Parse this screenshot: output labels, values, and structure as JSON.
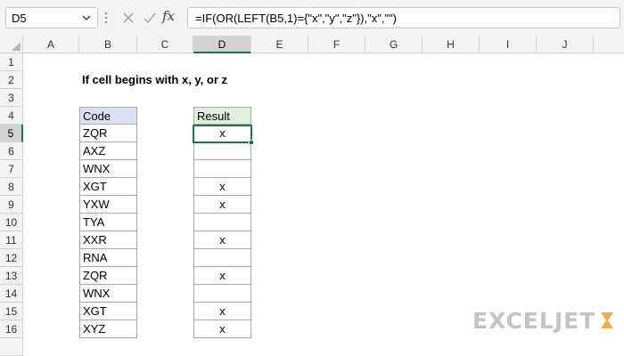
{
  "formula_bar": {
    "name_box": "D5",
    "fx_label": "fx",
    "formula": "=IF(OR(LEFT(B5,1)={\"x\",\"y\",\"z\"}),\"x\",\"\")"
  },
  "columns": [
    "A",
    "B",
    "C",
    "D",
    "E",
    "F",
    "G",
    "H",
    "I",
    "J"
  ],
  "active_column": "D",
  "rows": [
    "1",
    "2",
    "3",
    "4",
    "5",
    "6",
    "7",
    "8",
    "9",
    "10",
    "11",
    "12",
    "13",
    "14",
    "15",
    "16"
  ],
  "active_row": "5",
  "sheet": {
    "title": "If cell begins with x, y, or z",
    "code_header": "Code",
    "result_header": "Result",
    "codes": [
      "ZQR",
      "AXZ",
      "WNX",
      "XGT",
      "YXW",
      "TYA",
      "XXR",
      "RNA",
      "ZQR",
      "WNX",
      "XGT",
      "XYZ"
    ],
    "results": [
      "x",
      "",
      "",
      "x",
      "x",
      "",
      "x",
      "",
      "x",
      "",
      "x",
      "x"
    ]
  },
  "watermark": {
    "text": "EXCELJET",
    "color": "#c4c4c4",
    "accent": "#f0ad4e"
  },
  "colors": {
    "selection": "#217346",
    "code_header_fill": "#d9e1f2",
    "result_header_fill": "#e2efda"
  }
}
